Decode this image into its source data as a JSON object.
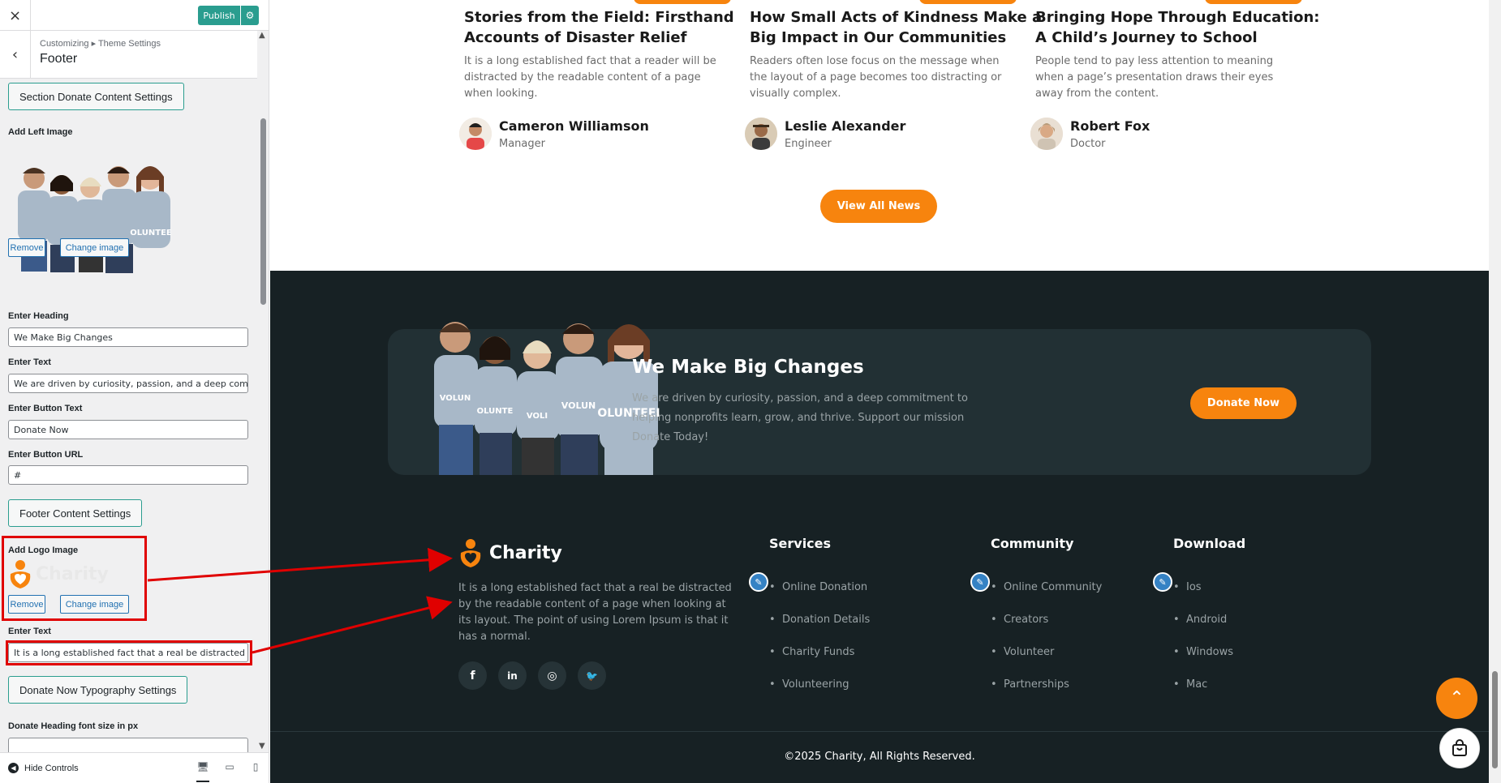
{
  "customizer": {
    "close_icon": "×",
    "publish_label": "Publish",
    "breadcrumb": "Customizing ▸ Theme Settings",
    "panel_title": "Footer",
    "section_donate_label": "Section Donate Content Settings",
    "add_left_image_label": "Add Left Image",
    "remove_label": "Remove",
    "change_image_label": "Change image",
    "enter_heading_label": "Enter Heading",
    "heading_value": "We Make Big Changes",
    "enter_text_label": "Enter Text",
    "text_value": "We are driven by curiosity, passion, and a deep commitm",
    "enter_button_text_label": "Enter Button Text",
    "button_text_value": "Donate Now",
    "enter_button_url_label": "Enter Button URL",
    "button_url_value": "#",
    "footer_content_label": "Footer Content Settings",
    "add_logo_label": "Add Logo Image",
    "logo_text": "Charity",
    "enter_text_label_2": "Enter Text",
    "footer_text_value": "It is a long established fact that a real be distracted by th",
    "typography_label": "Donate Now Typography Settings",
    "donate_heading_font_label": "Donate Heading font size in px",
    "hide_controls_label": "Hide Controls"
  },
  "news": [
    {
      "title_line1": "Stories from the Field: Firsthand",
      "title_line2": "Accounts of Disaster Relief",
      "text_line1": "It is a long established fact that a reader will be",
      "text_line2": "distracted by the readable content of a page",
      "text_line3": "when looking.",
      "author": "Cameron Williamson",
      "role": "Manager"
    },
    {
      "title_line1": "How Small Acts of Kindness Make a",
      "title_line2": "Big Impact in Our Communities",
      "text_line1": "Readers often lose focus on the message when",
      "text_line2": "the layout of a page becomes too distracting or",
      "text_line3": "visually complex.",
      "author": "Leslie Alexander",
      "role": "Engineer"
    },
    {
      "title_line1": "Bringing Hope Through Education:",
      "title_line2": "A Child’s Journey to School",
      "text_line1": "People tend to pay less attention to meaning",
      "text_line2": "when a page’s presentation draws their eyes",
      "text_line3": "away from the content.",
      "author": "Robert Fox",
      "role": "Doctor"
    }
  ],
  "view_all_label": "View All News",
  "donate": {
    "heading": "We Make Big Changes",
    "text_line1": "We are driven by curiosity, passion, and a deep commitment to",
    "text_line2": "helping nonprofits learn, grow, and thrive. Support our mission",
    "text_line3": "Donate Today!",
    "button": "Donate Now"
  },
  "footer": {
    "logo_text": "Charity",
    "desc_line1": "It is a long established fact that a real be distracted",
    "desc_line2": "by the readable content of a page when looking at",
    "desc_line3": "its layout. The point of using Lorem Ipsum is that it",
    "desc_line4": "has a normal.",
    "socials": [
      "f",
      "in",
      "◎",
      "🐦"
    ],
    "columns": [
      {
        "heading": "Services",
        "items": [
          "Online Donation",
          "Donation Details",
          "Charity Funds",
          "Volunteering"
        ]
      },
      {
        "heading": "Community",
        "items": [
          "Online Community",
          "Creators",
          "Volunteer",
          "Partnerships"
        ]
      },
      {
        "heading": "Download",
        "items": [
          "Ios",
          "Android",
          "Windows",
          "Mac"
        ]
      }
    ],
    "copyright": "©2025 Charity, All Rights Reserved."
  },
  "colors": {
    "accent": "#f7840e",
    "footer_bg": "#172124",
    "publish": "#2a9d8f",
    "annotation": "#e00000"
  }
}
